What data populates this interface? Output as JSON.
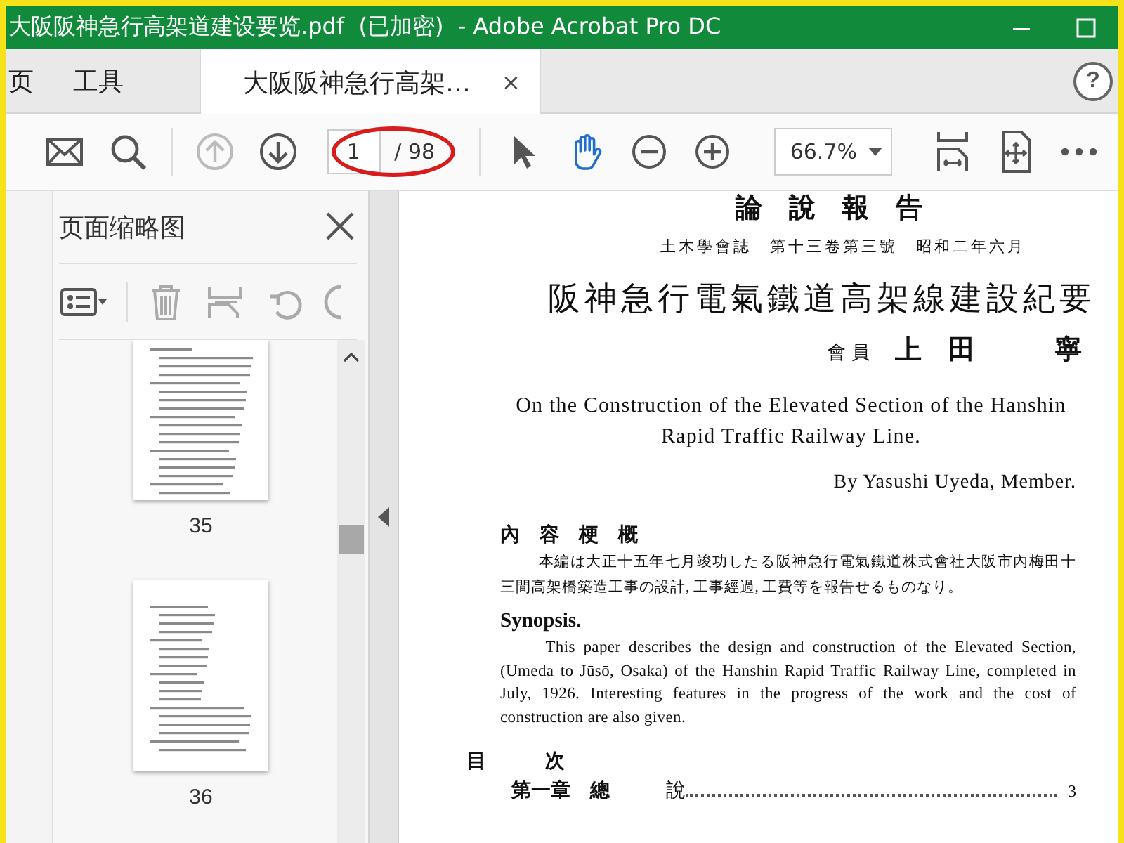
{
  "window": {
    "title": "大阪阪神急行高架道建设要览.pdf  (已加密)  - Adobe Acrobat Pro DC"
  },
  "tabs": [
    {
      "label": "页",
      "selected": false
    },
    {
      "label": "工具",
      "selected": false
    },
    {
      "label": "大阪阪神急行高架…",
      "selected": true,
      "close": "×"
    }
  ],
  "help": "?",
  "toolbar": {
    "nav": [
      {
        "kind": "prev",
        "disabled": true
      },
      {
        "kind": "next",
        "disabled": false
      }
    ],
    "page_value": "1",
    "page_total": "/ 98",
    "tools": [
      {
        "kind": "pointer",
        "selected": false
      },
      {
        "kind": "hand",
        "selected": true
      }
    ],
    "zoom": "66.7%"
  },
  "sidebar": {
    "title": "页面缩略图",
    "thumbnails": [
      {
        "page": "35",
        "cut": true
      },
      {
        "page": "36",
        "cut": false
      }
    ]
  },
  "document": {
    "header": "論　說　報　告",
    "journal": "土木學會誌　第十三卷第三號　昭和二年六月",
    "title": "阪神急行電氣鐵道高架線建設紀要",
    "author_role": "會員",
    "author_name": "上　田　　　寧",
    "english_title": "On the Construction of the Elevated Section of the Hanshin Rapid Traffic Railway Line.",
    "byline": "By Yasushi Uyeda, Member.",
    "abstract_heading": "內　容　梗　概",
    "abstract": "本編は大正十五年七月竣功したる阪神急行電氣鐵道株式會社大阪市內梅田十三間高架橋築造工事の設計, 工事經過, 工費等を報告せるものなり。",
    "synopsis_heading": "Synopsis.",
    "synopsis": "This paper describes the design and construction of the Elevated Section, (Umeda to Jūsō, Osaka) of the Hanshin Rapid Traffic Railway Line, completed in July, 1926.  Interesting features in the progress of the work and the cost of construction are also given.",
    "toc_heading": "目　　　次",
    "toc": [
      {
        "chapter": "第一章　總",
        "section": "說",
        "page": "3"
      }
    ]
  }
}
